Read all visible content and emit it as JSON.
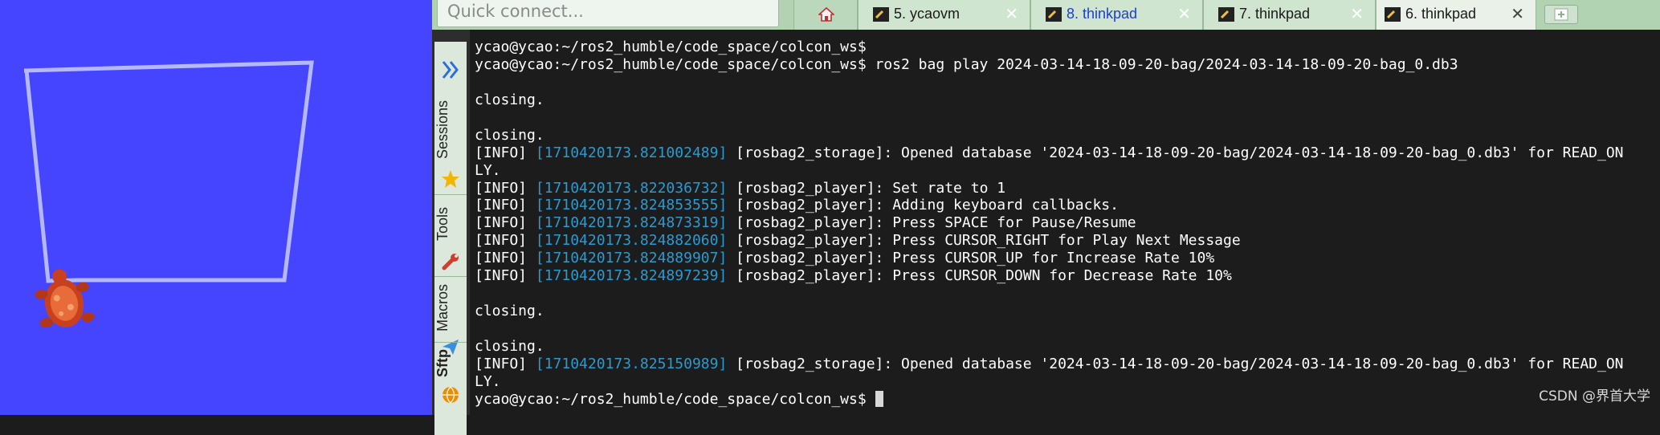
{
  "topbar": {
    "quick_connect_placeholder": "Quick connect...",
    "tabs": [
      {
        "label": "5. ycaovm",
        "active": false,
        "color": "#1a1a1a"
      },
      {
        "label": "8. thinkpad",
        "active": false,
        "color": "#1a3fd8"
      },
      {
        "label": "7. thinkpad",
        "active": false,
        "color": "#1a1a1a"
      },
      {
        "label": "6. thinkpad",
        "active": true,
        "color": "#1a1a1a"
      }
    ],
    "close_glyph": "✕"
  },
  "sidebar": {
    "sections": [
      {
        "label": "Sessions",
        "icon": "star-icon"
      },
      {
        "label": "Tools",
        "icon": "wrench-icon"
      },
      {
        "label": "Macros",
        "icon": "paper-plane-icon"
      },
      {
        "label": "Sftp",
        "icon": "globe-icon"
      }
    ]
  },
  "terminal": {
    "lines": [
      {
        "text": "ycao@ycao:~/ros2_humble/code_space/colcon_ws$"
      },
      {
        "text": "ycao@ycao:~/ros2_humble/code_space/colcon_ws$ ros2 bag play 2024-03-14-18-09-20-bag/2024-03-14-18-09-20-bag_0.db3"
      },
      {
        "text": ""
      },
      {
        "text": "closing."
      },
      {
        "text": ""
      },
      {
        "text": "closing."
      },
      {
        "level": "[INFO]",
        "ts": "[1710420173.821002489]",
        "text": " [rosbag2_storage]: Opened database '2024-03-14-18-09-20-bag/2024-03-14-18-09-20-bag_0.db3' for READ_ON"
      },
      {
        "text": "LY."
      },
      {
        "level": "[INFO]",
        "ts": "[1710420173.822036732]",
        "text": " [rosbag2_player]: Set rate to 1"
      },
      {
        "level": "[INFO]",
        "ts": "[1710420173.824853555]",
        "text": " [rosbag2_player]: Adding keyboard callbacks."
      },
      {
        "level": "[INFO]",
        "ts": "[1710420173.824873319]",
        "text": " [rosbag2_player]: Press SPACE for Pause/Resume"
      },
      {
        "level": "[INFO]",
        "ts": "[1710420173.824882060]",
        "text": " [rosbag2_player]: Press CURSOR_RIGHT for Play Next Message"
      },
      {
        "level": "[INFO]",
        "ts": "[1710420173.824889907]",
        "text": " [rosbag2_player]: Press CURSOR_UP for Increase Rate 10%"
      },
      {
        "level": "[INFO]",
        "ts": "[1710420173.824897239]",
        "text": " [rosbag2_player]: Press CURSOR_DOWN for Decrease Rate 10%"
      },
      {
        "text": ""
      },
      {
        "text": "closing."
      },
      {
        "text": ""
      },
      {
        "text": "closing."
      },
      {
        "level": "[INFO]",
        "ts": "[1710420173.825150989]",
        "text": " [rosbag2_storage]: Opened database '2024-03-14-18-09-20-bag/2024-03-14-18-09-20-bag_0.db3' for READ_ON"
      },
      {
        "text": "LY."
      },
      {
        "text": "ycao@ycao:~/ros2_humble/code_space/colcon_ws$ ",
        "cursor": true
      }
    ]
  },
  "watermark": "CSDN @界首大学",
  "colors": {
    "turtlesim_bg": "#4545ff",
    "turtle_path": "#b3b8ff",
    "terminal_bg": "#1c1c1c",
    "timestamp": "#2a9bd0",
    "tab_bar": "#b2d3b2"
  }
}
